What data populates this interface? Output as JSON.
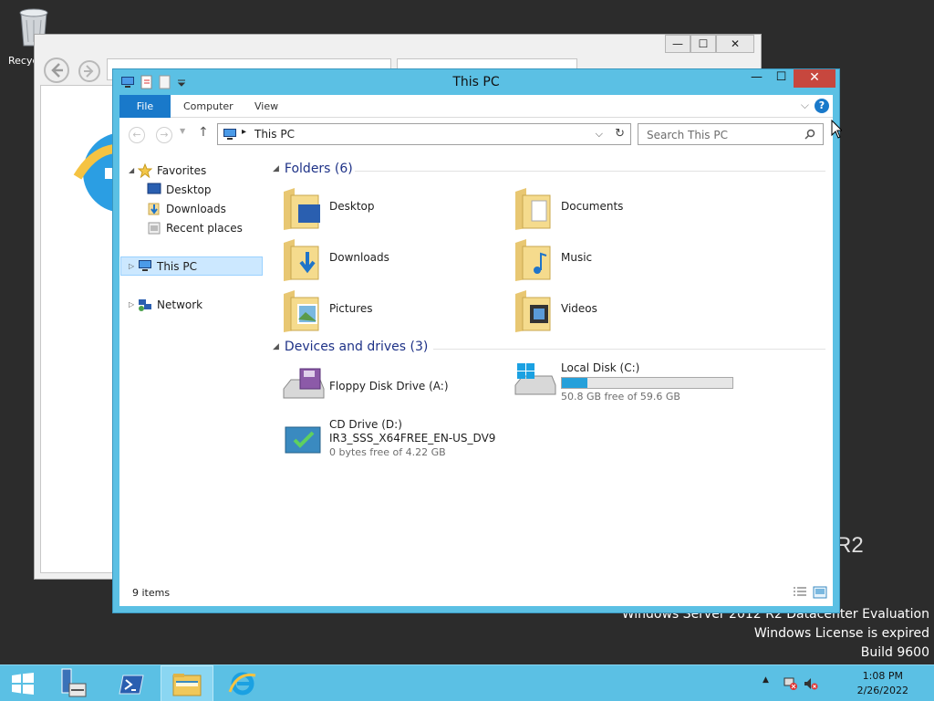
{
  "desktop": {
    "recycle_bin_label": "Recyc",
    "watermark": {
      "r2_fragment": "R2",
      "edition": "Windows Server 2012 R2 Datacenter Evaluation",
      "license": "Windows License is expired",
      "build": "Build 9600"
    }
  },
  "ie_window": {
    "minimize": "—",
    "maximize": "☐",
    "close": "✕"
  },
  "explorer": {
    "title": "This PC",
    "ribbon": {
      "tabs": [
        {
          "label": "File"
        },
        {
          "label": "Computer"
        },
        {
          "label": "View"
        }
      ],
      "help": "?"
    },
    "address": {
      "path": "This PC",
      "search_placeholder": "Search This PC"
    },
    "nav": {
      "favorites": "Favorites",
      "desktop": "Desktop",
      "downloads": "Downloads",
      "recent": "Recent places",
      "this_pc": "This PC",
      "network": "Network"
    },
    "folders_header": "Folders (6)",
    "folders": [
      {
        "label": "Desktop"
      },
      {
        "label": "Documents"
      },
      {
        "label": "Downloads"
      },
      {
        "label": "Music"
      },
      {
        "label": "Pictures"
      },
      {
        "label": "Videos"
      }
    ],
    "devices_header": "Devices and drives (3)",
    "devices": {
      "floppy": {
        "label": "Floppy Disk Drive (A:)"
      },
      "local": {
        "label": "Local Disk (C:)",
        "free": "50.8 GB free of 59.6 GB",
        "used_fraction": 0.148
      },
      "cd": {
        "label": "CD Drive (D:)",
        "volume": "IR3_SSS_X64FREE_EN-US_DV9",
        "free": "0 bytes free of 4.22 GB"
      }
    },
    "status": "9 items",
    "controls": {
      "minimize": "—",
      "maximize": "☐",
      "close": "✕"
    }
  },
  "taskbar": {
    "time": "1:08 PM",
    "date": "2/26/2022"
  },
  "colors": {
    "accent": "#5bc0e4",
    "file_tab": "#1979ca",
    "close": "#c7473e",
    "drive_fill": "#26a0da",
    "group_header": "#1e3287"
  }
}
